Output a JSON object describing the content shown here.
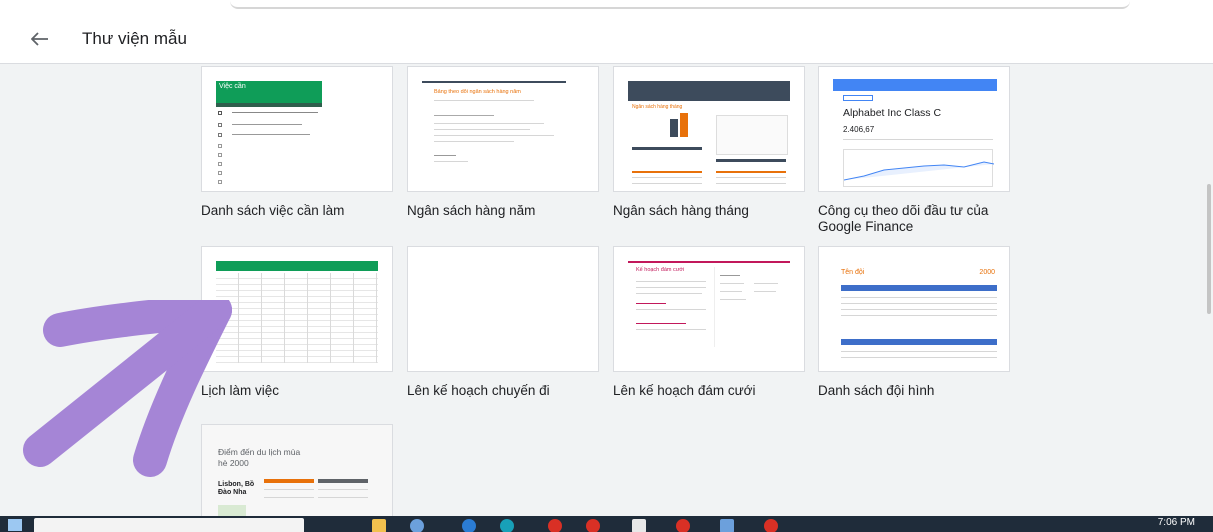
{
  "header": {
    "title": "Thư viện mẫu"
  },
  "templates": [
    {
      "label": "Danh sách việc cần làm"
    },
    {
      "label": "Ngân sách hàng năm"
    },
    {
      "label": "Ngân sách hàng tháng"
    },
    {
      "label": "Công cụ theo dõi đầu tư của Google Finance"
    },
    {
      "label": "Lịch làm việc"
    },
    {
      "label": "Lên kế hoạch chuyến đi"
    },
    {
      "label": "Lên kế hoạch đám cưới"
    },
    {
      "label": "Danh sách đội hình"
    },
    {
      "label": ""
    }
  ],
  "thumbs": {
    "todo_title": "Việc cần",
    "annual_title": "Bảng theo dõi ngân sách hàng năm",
    "monthly_title": "Ngân sách hàng tháng",
    "finance_title": "Alphabet Inc Class C",
    "finance_value": "2.406,67",
    "wedding_title": "Kế hoạch đám cưới",
    "roster_title": "Tên đội",
    "roster_year": "2000",
    "travel_title": "Điểm đến du lịch mùa hè 2000",
    "travel_city": "Lisbon, Bồ Đào Nha"
  },
  "taskbar": {
    "time": "7:06 PM"
  },
  "colors": {
    "accent_green": "#0f9d58",
    "accent_orange": "#e8710a",
    "overlay_purple": "#a585d6"
  }
}
